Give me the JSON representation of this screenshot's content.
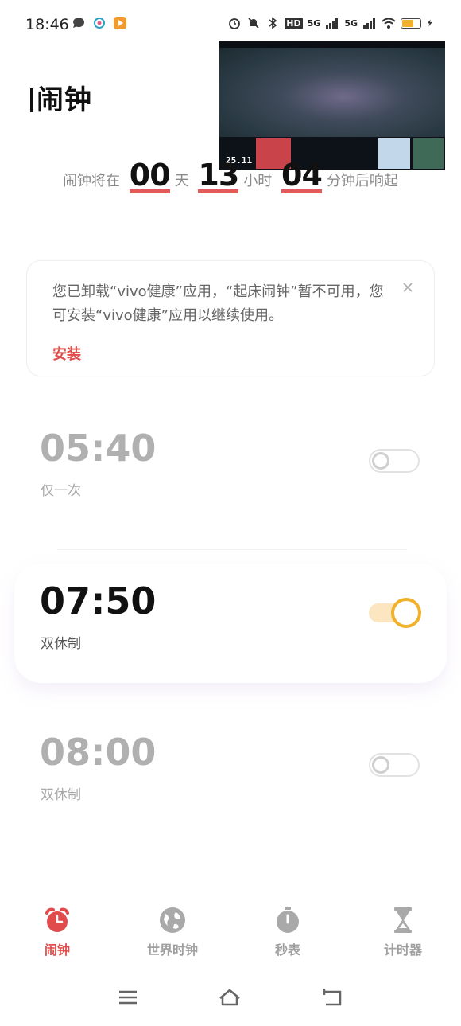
{
  "status_bar": {
    "time": "18:46",
    "hd_label": "HD",
    "network_1": "5G",
    "network_2": "5G",
    "battery_level": 0.6,
    "accent": "#f2b12b"
  },
  "header": {
    "title": "闹钟"
  },
  "pip_video": {
    "score_text": "25.11"
  },
  "countdown": {
    "prefix": "闹钟将在",
    "days": "00",
    "days_unit": "天",
    "hours": "13",
    "hours_unit": "小时",
    "minutes": "04",
    "minutes_unit": "分钟后响起"
  },
  "notice": {
    "text": "您已卸载“vivo健康”应用，“起床闹钟”暂不可用，您可安装“vivo健康”应用以继续使用。",
    "install_label": "安装",
    "close_icon": "close-icon"
  },
  "alarms": [
    {
      "time": "05:40",
      "label": "仅一次",
      "enabled": false
    },
    {
      "time": "07:50",
      "label": "双休制",
      "enabled": true
    },
    {
      "time": "08:00",
      "label": "双休制",
      "enabled": false
    }
  ],
  "bottom_nav": {
    "items": [
      {
        "label": "闹钟",
        "icon": "alarm-clock-icon",
        "active": true
      },
      {
        "label": "世界时钟",
        "icon": "globe-icon",
        "active": false
      },
      {
        "label": "秒表",
        "icon": "stopwatch-icon",
        "active": false
      },
      {
        "label": "计时器",
        "icon": "hourglass-icon",
        "active": false
      }
    ]
  },
  "colors": {
    "accent_red": "#e14b4b",
    "toggle_on": "#f2b12b",
    "muted": "#a0a0a0"
  }
}
